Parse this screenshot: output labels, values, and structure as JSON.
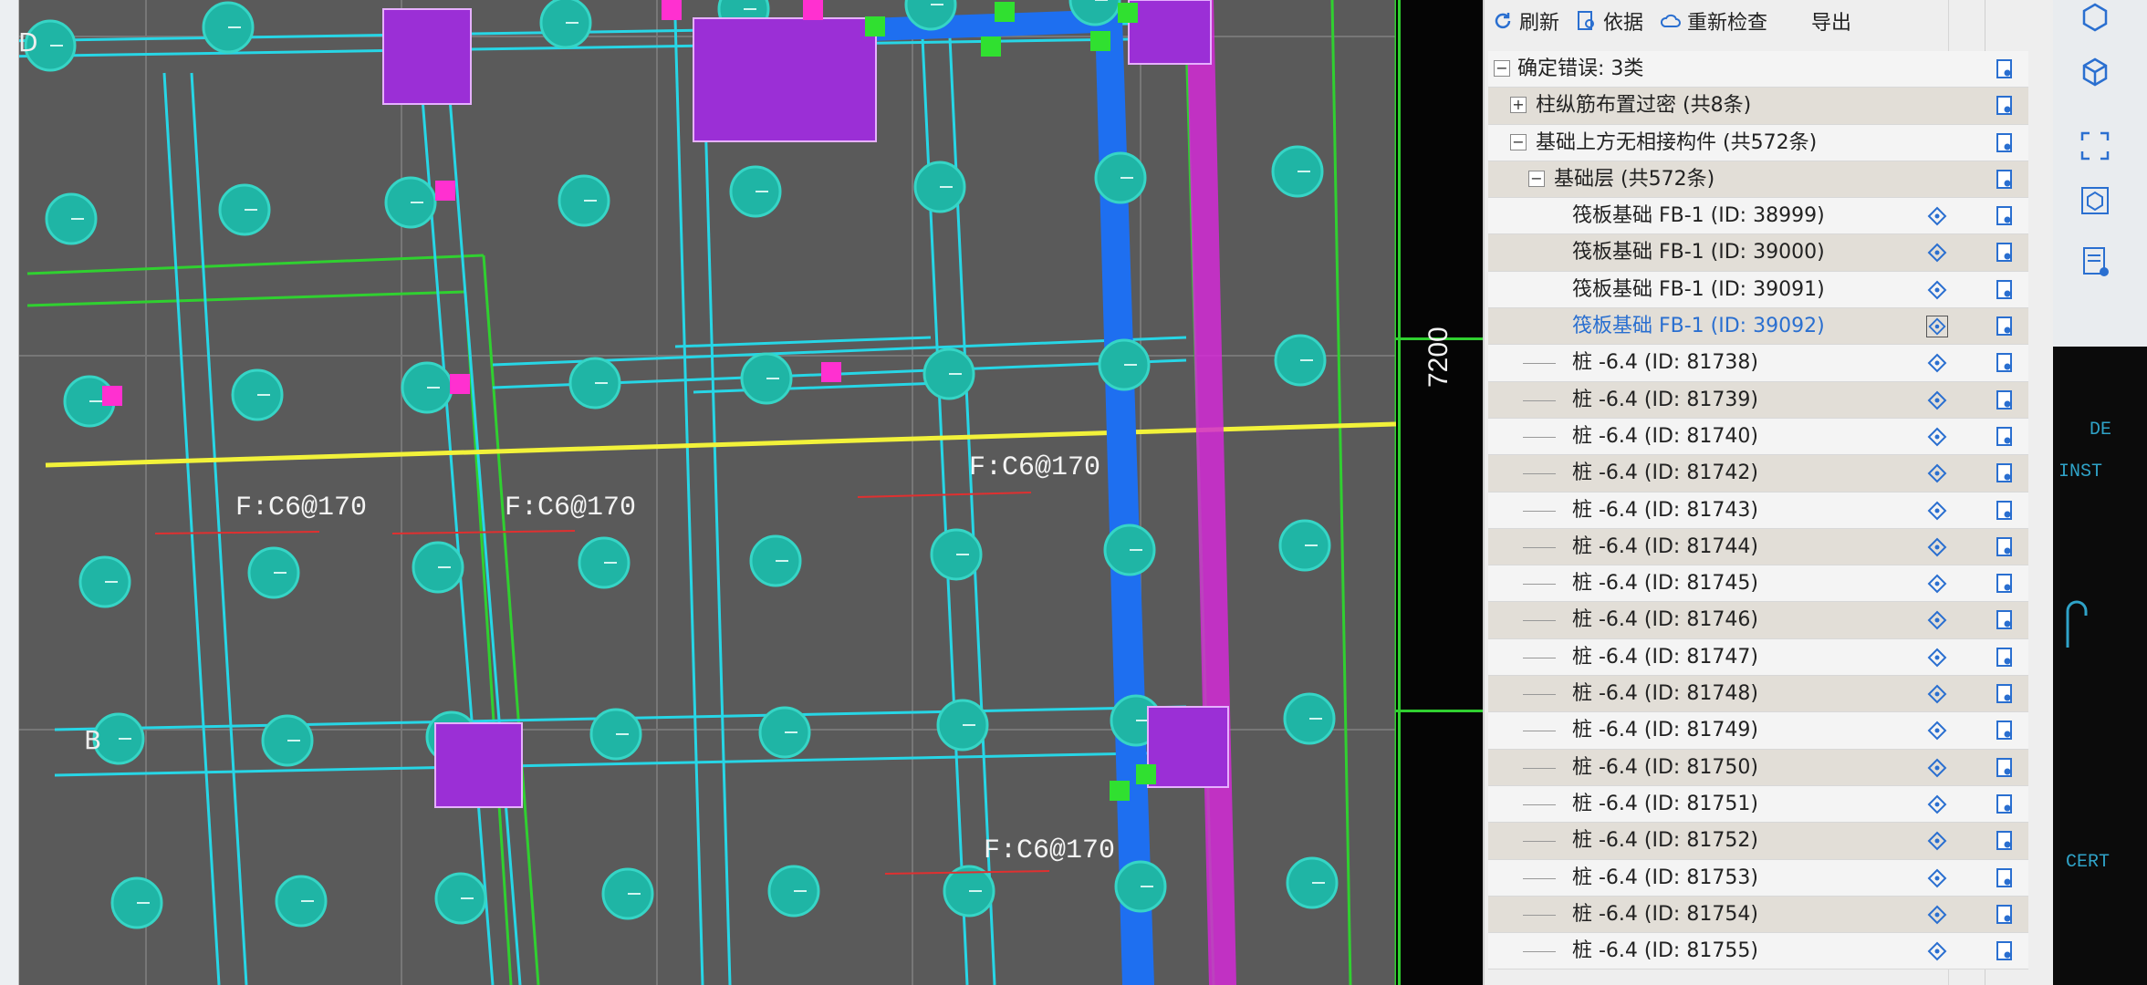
{
  "cad": {
    "dimension": "7200",
    "axis_labels": [
      "D",
      "B"
    ],
    "annotations": [
      "F:C6@170",
      "F:C6@170",
      "F:C6@170",
      "F:C6@170"
    ]
  },
  "toolbar": {
    "refresh": "刷新",
    "basis": "依据",
    "recheck": "重新检查",
    "export": "导出"
  },
  "tree": {
    "root": "确定错误: 3类",
    "group1": "柱纵筋布置过密 (共8条)",
    "group2": "基础上方无相接构件 (共572条)",
    "sub": "基础层 (共572条)",
    "items": [
      "筏板基础 FB-1 (ID: 38999)",
      "筏板基础 FB-1 (ID: 39000)",
      "筏板基础 FB-1 (ID: 39091)",
      "筏板基础 FB-1 (ID: 39092)",
      "桩 -6.4 (ID: 81738)",
      "桩 -6.4 (ID: 81739)",
      "桩 -6.4 (ID: 81740)",
      "桩 -6.4 (ID: 81742)",
      "桩 -6.4 (ID: 81743)",
      "桩 -6.4 (ID: 81744)",
      "桩 -6.4 (ID: 81745)",
      "桩 -6.4 (ID: 81746)",
      "桩 -6.4 (ID: 81747)",
      "桩 -6.4 (ID: 81748)",
      "桩 -6.4 (ID: 81749)",
      "桩 -6.4 (ID: 81750)",
      "桩 -6.4 (ID: 81751)",
      "桩 -6.4 (ID: 81752)",
      "桩 -6.4 (ID: 81753)",
      "桩 -6.4 (ID: 81754)",
      "桩 -6.4 (ID: 81755)"
    ],
    "selected_index": 3
  },
  "rightbar": {
    "texts": [
      "DE",
      "INST",
      "CERT"
    ]
  },
  "colors": {
    "canvas": "#5a5a5a",
    "pile": "#1fb5a5",
    "beam": "#27d6e6",
    "column": "#9b2fd6",
    "wall": "#1e6ff0",
    "axis": "#f2f23a",
    "selected_text": "#2a6fd0"
  }
}
